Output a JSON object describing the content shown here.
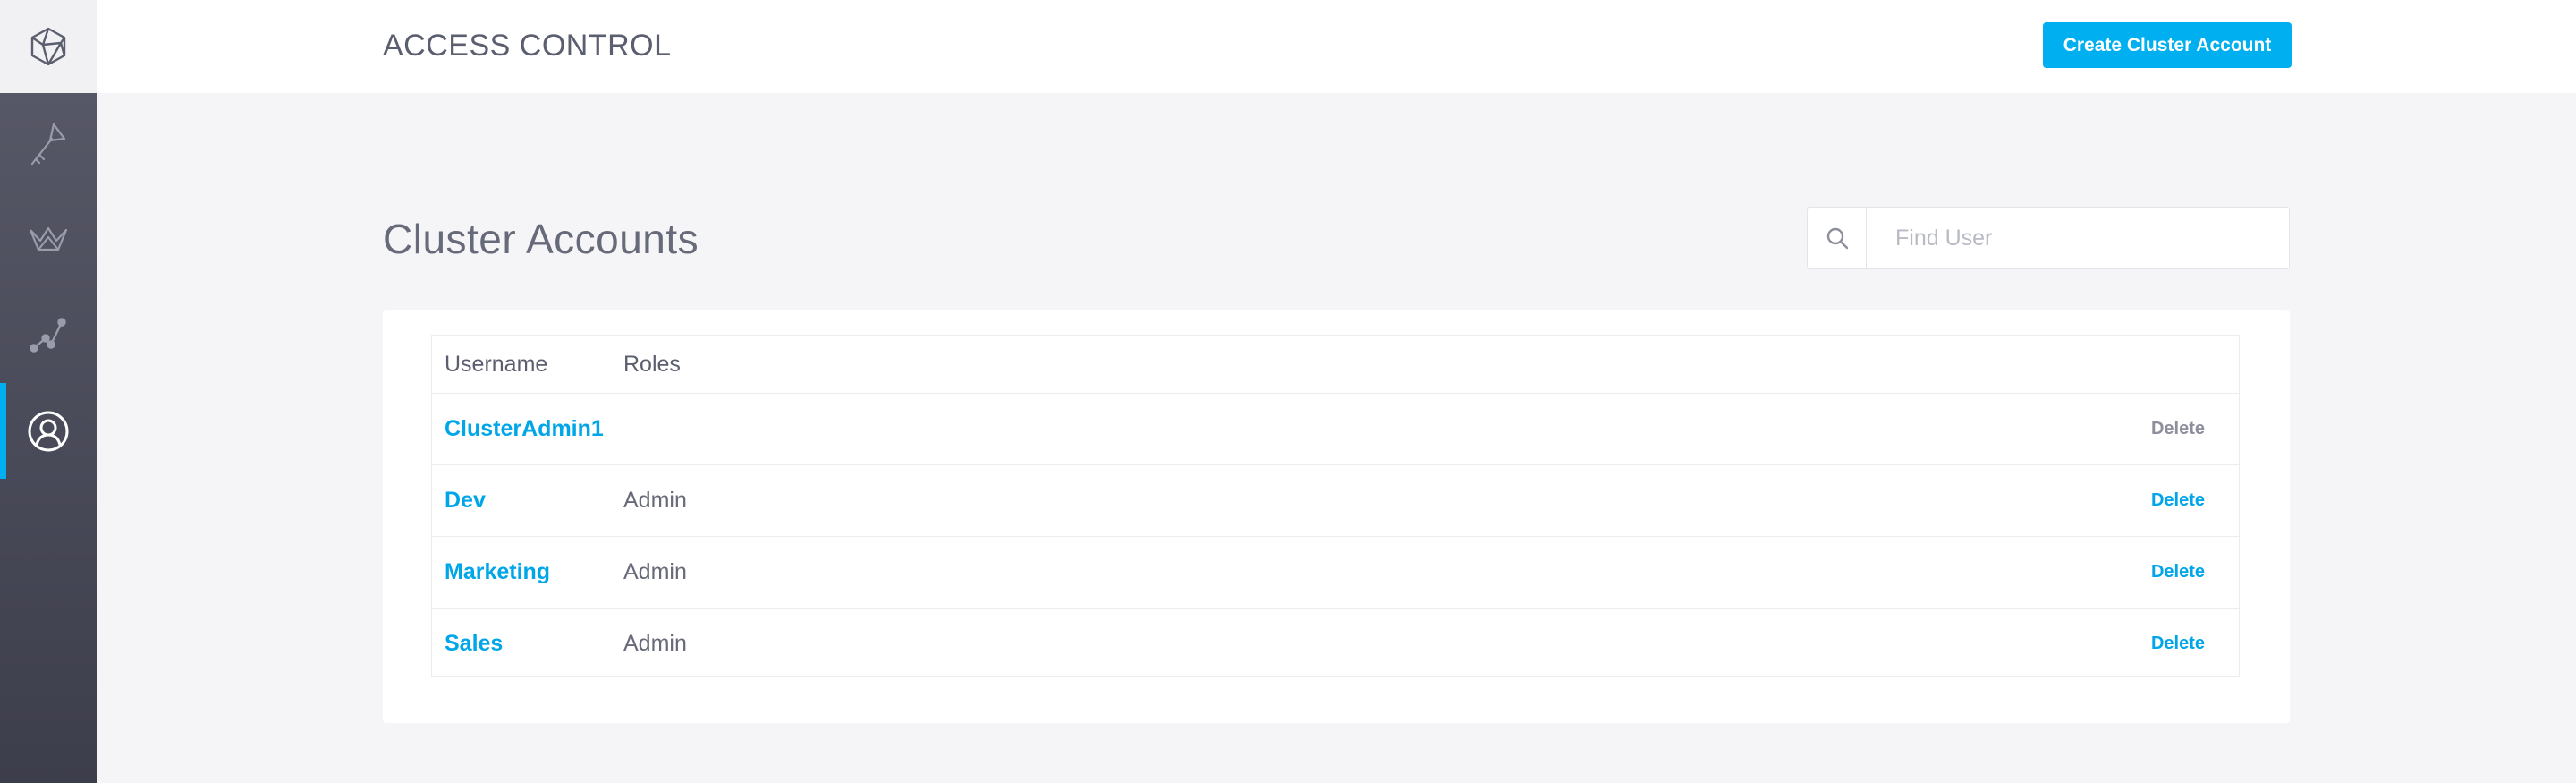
{
  "header": {
    "title": "ACCESS CONTROL",
    "create_button": "Create Cluster Account"
  },
  "sidebar": {
    "items": [
      {
        "icon": "polyhedron-logo-icon",
        "active": false
      },
      {
        "icon": "key-icon",
        "active": false
      },
      {
        "icon": "crown-icon",
        "active": false
      },
      {
        "icon": "graph-nodes-icon",
        "active": false
      },
      {
        "icon": "user-circle-icon",
        "active": true
      }
    ]
  },
  "main": {
    "section_title": "Cluster Accounts",
    "search": {
      "placeholder": "Find User",
      "value": ""
    },
    "table": {
      "headers": {
        "username": "Username",
        "roles": "Roles"
      },
      "rows": [
        {
          "username": "ClusterAdmin1",
          "roles": "",
          "action": "Delete",
          "action_enabled": false
        },
        {
          "username": "Dev",
          "roles": "Admin",
          "action": "Delete",
          "action_enabled": true
        },
        {
          "username": "Marketing",
          "roles": "Admin",
          "action": "Delete",
          "action_enabled": true
        },
        {
          "username": "Sales",
          "roles": "Admin",
          "action": "Delete",
          "action_enabled": true
        }
      ]
    }
  },
  "colors": {
    "accent": "#00aff0",
    "link": "#00a6e8",
    "sidebar_top": "#5a5b6a",
    "sidebar_bottom": "#3d3e4c",
    "disabled_text": "#8d909c"
  }
}
